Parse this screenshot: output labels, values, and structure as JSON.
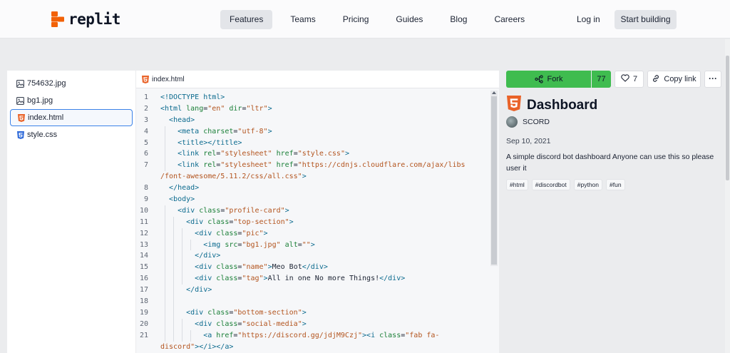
{
  "colors": {
    "accent_green": "#3fbc4f",
    "brand_orange": "#f26207",
    "focus_blue": "#3b82e8"
  },
  "brand": {
    "name": "replit"
  },
  "nav": {
    "items": [
      {
        "label": "Features",
        "active": true
      },
      {
        "label": "Teams"
      },
      {
        "label": "Pricing"
      },
      {
        "label": "Guides"
      },
      {
        "label": "Blog"
      },
      {
        "label": "Careers"
      }
    ],
    "login": "Log in",
    "start": "Start building"
  },
  "files": [
    {
      "name": "754632.jpg",
      "icon": "image-icon"
    },
    {
      "name": "bg1.jpg",
      "icon": "image-icon"
    },
    {
      "name": "index.html",
      "icon": "html5-icon",
      "active": true
    },
    {
      "name": "style.css",
      "icon": "css3-icon"
    }
  ],
  "editor": {
    "tab": "index.html",
    "lines": [
      {
        "n": "1",
        "html": "<span class=\"tag\">&lt;!DOCTYPE html&gt;</span>",
        "indent": 0
      },
      {
        "n": "2",
        "html": "<span class=\"tag\">&lt;html</span> <span class=\"attr\">lang</span>=<span class=\"str\">\"en\"</span> <span class=\"attr\">dir</span>=<span class=\"str\">\"ltr\"</span><span class=\"tag\">&gt;</span>",
        "indent": 0
      },
      {
        "n": "3",
        "html": "  <span class=\"tag\">&lt;head&gt;</span>",
        "indent": 0
      },
      {
        "n": "4",
        "html": "    <span class=\"tag\">&lt;meta</span> <span class=\"attr\">charset</span>=<span class=\"str\">\"utf-8\"</span><span class=\"tag\">&gt;</span>",
        "indent": 1
      },
      {
        "n": "5",
        "html": "    <span class=\"tag\">&lt;title&gt;&lt;/title&gt;</span>",
        "indent": 1
      },
      {
        "n": "6",
        "html": "    <span class=\"tag\">&lt;link</span> <span class=\"attr\">rel</span>=<span class=\"str\">\"stylesheet\"</span> <span class=\"attr\">href</span>=<span class=\"str\">\"style.css\"</span><span class=\"tag\">&gt;</span>",
        "indent": 1
      },
      {
        "n": "7",
        "html": "    <span class=\"tag\">&lt;link</span> <span class=\"attr\">rel</span>=<span class=\"str\">\"stylesheet\"</span> <span class=\"attr\">href</span>=<span class=\"str\">\"https://cdnjs.cloudflare.com/ajax/libs</span>",
        "indent": 1
      },
      {
        "n": "",
        "html": "<span class=\"str\">/font-awesome/5.11.2/css/all.css\"</span><span class=\"tag\">&gt;</span>",
        "indent": 0
      },
      {
        "n": "8",
        "html": "  <span class=\"tag\">&lt;/head&gt;</span>",
        "indent": 0
      },
      {
        "n": "9",
        "html": "  <span class=\"tag\">&lt;body&gt;</span>",
        "indent": 0
      },
      {
        "n": "10",
        "html": "    <span class=\"tag\">&lt;div</span> <span class=\"attr\">class</span>=<span class=\"str\">\"profile-card\"</span><span class=\"tag\">&gt;</span>",
        "indent": 1
      },
      {
        "n": "11",
        "html": "      <span class=\"tag\">&lt;div</span> <span class=\"attr\">class</span>=<span class=\"str\">\"top-section\"</span><span class=\"tag\">&gt;</span>",
        "indent": 2
      },
      {
        "n": "12",
        "html": "        <span class=\"tag\">&lt;div</span> <span class=\"attr\">class</span>=<span class=\"str\">\"pic\"</span><span class=\"tag\">&gt;</span>",
        "indent": 3
      },
      {
        "n": "13",
        "html": "          <span class=\"tag\">&lt;img</span> <span class=\"attr\">src</span>=<span class=\"str\">\"bg1.jpg\"</span> <span class=\"attr\">alt</span>=<span class=\"str\">\"\"</span><span class=\"tag\">&gt;</span>",
        "indent": 4
      },
      {
        "n": "14",
        "html": "        <span class=\"tag\">&lt;/div&gt;</span>",
        "indent": 3
      },
      {
        "n": "15",
        "html": "        <span class=\"tag\">&lt;div</span> <span class=\"attr\">class</span>=<span class=\"str\">\"name\"</span><span class=\"tag\">&gt;</span>Meo Bot<span class=\"tag\">&lt;/div&gt;</span>",
        "indent": 3
      },
      {
        "n": "16",
        "html": "        <span class=\"tag\">&lt;div</span> <span class=\"attr\">class</span>=<span class=\"str\">\"tag\"</span><span class=\"tag\">&gt;</span>All in one No more Things!<span class=\"tag\">&lt;/div&gt;</span>",
        "indent": 3
      },
      {
        "n": "17",
        "html": "      <span class=\"tag\">&lt;/div&gt;</span>",
        "indent": 2
      },
      {
        "n": "18",
        "html": "",
        "indent": 2
      },
      {
        "n": "19",
        "html": "      <span class=\"tag\">&lt;div</span> <span class=\"attr\">class</span>=<span class=\"str\">\"bottom-section\"</span><span class=\"tag\">&gt;</span>",
        "indent": 2
      },
      {
        "n": "20",
        "html": "        <span class=\"tag\">&lt;div</span> <span class=\"attr\">class</span>=<span class=\"str\">\"social-media\"</span><span class=\"tag\">&gt;</span>",
        "indent": 3
      },
      {
        "n": "21",
        "html": "          <span class=\"tag\">&lt;a</span> <span class=\"attr\">href</span>=<span class=\"str\">\"https://discord.gg/jdjM9Czj\"</span><span class=\"tag\">&gt;&lt;i</span> <span class=\"attr\">class</span>=<span class=\"str\">\"fab fa-</span>",
        "indent": 4
      },
      {
        "n": "",
        "html": "<span class=\"str\">discord\"</span><span class=\"tag\">&gt;&lt;/i&gt;&lt;/a&gt;</span>",
        "indent": 0
      }
    ]
  },
  "repl": {
    "fork_label": "Fork",
    "fork_count": "77",
    "likes": "7",
    "copy_label": "Copy link",
    "more_label": "···",
    "title": "Dashboard",
    "author": "SCORD",
    "date": "Sep 10, 2021",
    "description": "A simple discord bot dashboard Anyone can use this so please user it",
    "tags": [
      "#html",
      "#discordbot",
      "#python",
      "#fun"
    ]
  }
}
